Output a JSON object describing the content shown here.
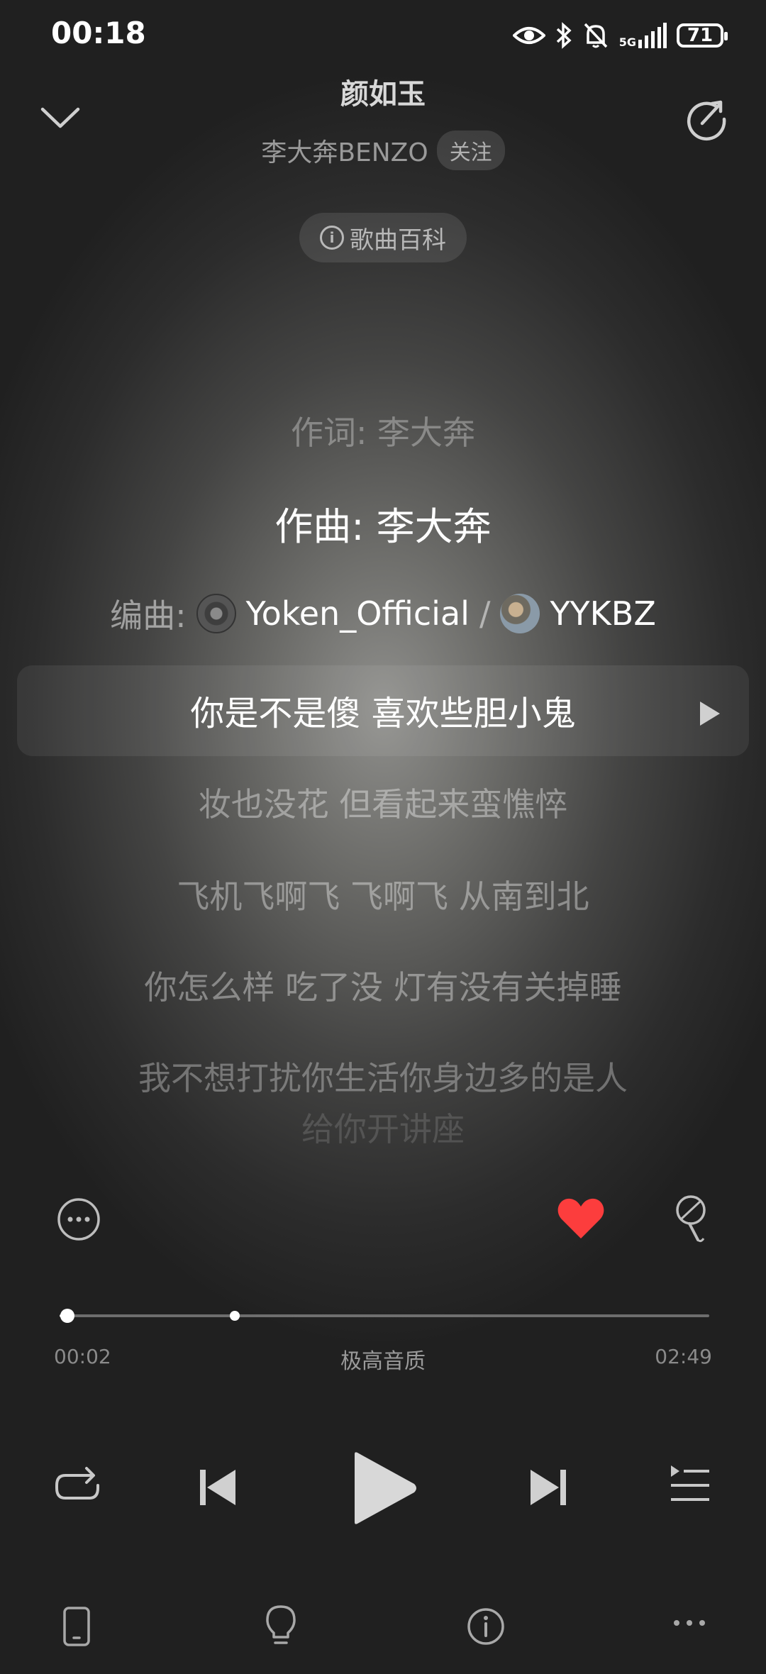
{
  "status_bar": {
    "time": "00:18",
    "network": "5G",
    "battery": "71"
  },
  "header": {
    "title": "颜如玉",
    "artist": "李大奔BENZO",
    "follow_label": "关注",
    "wiki_label": "歌曲百科"
  },
  "lyrics": {
    "lyricist": "作词: 李大奔",
    "composer": "作曲: 李大奔",
    "arranger_label": "编曲:",
    "arrangers": [
      "Yoken_Official",
      "YYKBZ"
    ],
    "separator": "/",
    "lines": [
      "你是不是傻 喜欢些胆小鬼",
      "妆也没花 但看起来蛮憔悴",
      "飞机飞啊飞 飞啊飞 从南到北",
      "你怎么样 吃了没 灯有没有关掉睡",
      "我不想打扰你生活你身边多的是人",
      "给你开讲座"
    ]
  },
  "player": {
    "time_current": "00:02",
    "time_total": "02:49",
    "quality": "极高音质",
    "progress": 0.012,
    "buffered": 0.27,
    "liked": true,
    "like_color": "#fc3d3d"
  },
  "icons": {
    "top_left": "chevron-down-icon",
    "top_right": "share-icon",
    "action_left": "more-options-icon",
    "action_like": "heart-icon",
    "action_sing": "microphone-icon",
    "controls": [
      "repeat-icon",
      "previous-icon",
      "play-icon",
      "next-icon",
      "playlist-icon"
    ],
    "bottom": [
      "device-icon",
      "lightbulb-icon",
      "info-icon",
      "more-icon"
    ]
  }
}
